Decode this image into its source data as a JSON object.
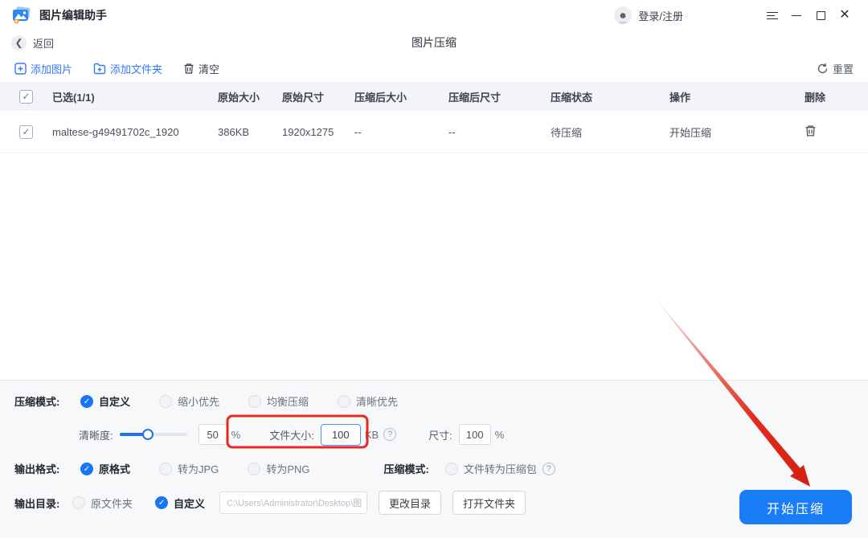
{
  "app": {
    "title": "图片编辑助手",
    "login_label": "登录/注册"
  },
  "nav": {
    "back_label": "返回",
    "page_title": "图片压缩"
  },
  "toolbar": {
    "add_image": "添加图片",
    "add_folder": "添加文件夹",
    "clear": "清空",
    "reset": "重置"
  },
  "table": {
    "headers": {
      "selected": "已选(1/1)",
      "orig_size": "原始大小",
      "orig_dim": "原始尺寸",
      "comp_size": "压缩后大小",
      "comp_dim": "压缩后尺寸",
      "status": "压缩状态",
      "action": "操作",
      "delete": "删除"
    },
    "rows": [
      {
        "name": "maltese-g49491702c_1920",
        "orig_size": "386KB",
        "orig_dim": "1920x1275",
        "comp_size": "--",
        "comp_dim": "--",
        "status": "待压缩",
        "action": "开始压缩"
      }
    ]
  },
  "settings": {
    "compress_mode": {
      "label": "压缩模式:",
      "options": [
        "自定义",
        "缩小优先",
        "均衡压缩",
        "清晰优先"
      ],
      "selected": "自定义"
    },
    "clarity": {
      "label": "清晰度:",
      "value": "50",
      "unit": "%"
    },
    "file_size": {
      "label": "文件大小:",
      "value": "100",
      "unit": "KB"
    },
    "dimension": {
      "label": "尺寸:",
      "value": "100",
      "unit": "%"
    },
    "output_format": {
      "label": "输出格式:",
      "options": [
        "原格式",
        "转为JPG",
        "转为PNG"
      ],
      "selected": "原格式"
    },
    "archive_mode": {
      "label": "压缩模式:",
      "option": "文件转为压缩包"
    },
    "output_dir": {
      "label": "输出目录:",
      "options": [
        "原文件夹",
        "自定义"
      ],
      "selected": "自定义",
      "path": "C:\\Users\\Administrator\\Desktop\\图",
      "change_btn": "更改目录",
      "open_btn": "打开文件夹"
    },
    "start_button": "开始压缩"
  },
  "colors": {
    "accent": "#1677f5",
    "button_blue": "#1a7df8",
    "annotation_red": "#e22b1d"
  }
}
